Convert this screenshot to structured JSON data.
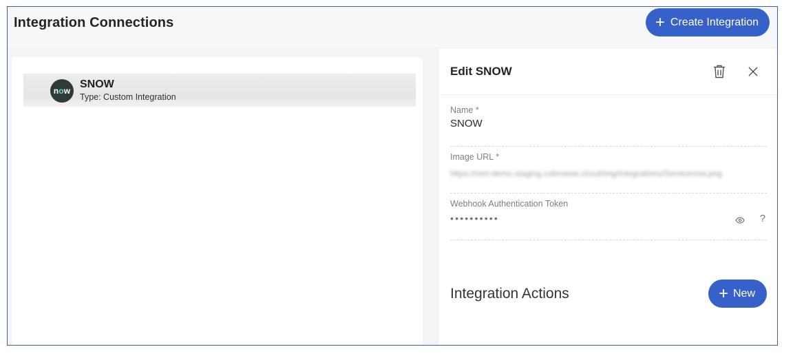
{
  "header": {
    "title": "Integration Connections",
    "create_button": {
      "icon": "plus-icon",
      "label": "Create Integration"
    }
  },
  "integrations": [
    {
      "avatar_text": "now",
      "name": "SNOW",
      "type": "Type: Custom Integration"
    }
  ],
  "edit_panel": {
    "title": "Edit SNOW",
    "fields": {
      "name": {
        "label": "Name *",
        "value": "SNOW"
      },
      "image_url": {
        "label": "Image URL *",
        "value": "https://cert-demo.staging.cobrowse.cloud/img/integrations/Servicenow.png"
      },
      "webhook_token": {
        "label": "Webhook Authentication Token",
        "value": "••••••••••"
      }
    },
    "actions_section": {
      "title": "Integration Actions",
      "new_button": "New"
    }
  },
  "colors": {
    "accent": "#3561c9",
    "frame_border": "#3a5fb0",
    "avatar_bg": "#2e3b3a"
  }
}
